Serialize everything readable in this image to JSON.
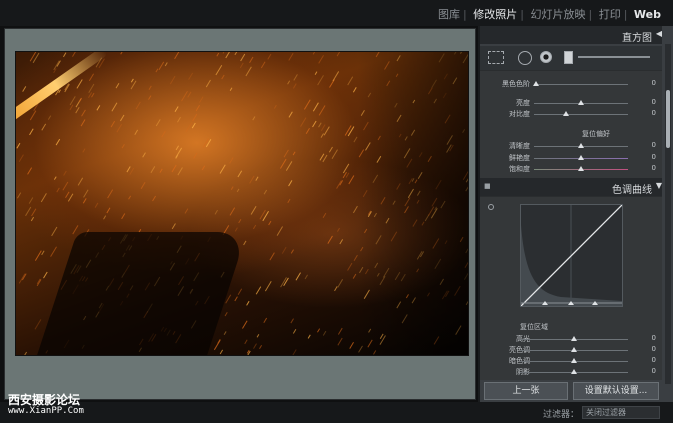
{
  "modules": [
    "图库",
    "修改照片",
    "幻灯片放映",
    "打印",
    "Web"
  ],
  "active_module": "修改照片",
  "panel": {
    "histogram_title": "直方图",
    "color_section": {
      "rows": [
        {
          "label": "黑色色阶",
          "value": "0",
          "pos": 0.05
        }
      ],
      "presence_rows": [
        {
          "label": "亮度",
          "value": "0",
          "pos": 0.5
        },
        {
          "label": "对比度",
          "value": "0",
          "pos": 0.5
        }
      ],
      "presence_title": "复位偏好",
      "clarity_rows": [
        {
          "label": "清晰度",
          "value": "0",
          "pos": 0.5
        },
        {
          "label": "鲜艳度",
          "value": "0",
          "pos": 0.5
        },
        {
          "label": "饱和度",
          "value": "0",
          "pos": 0.5
        }
      ]
    },
    "tone_curve_title": "色调曲线",
    "region_title": "复位区域",
    "region_rows": [
      {
        "label": "高光",
        "value": "0",
        "pos": 0.5
      },
      {
        "label": "亮色调",
        "value": "0",
        "pos": 0.5
      },
      {
        "label": "暗色调",
        "value": "0",
        "pos": 0.5
      },
      {
        "label": "阴影",
        "value": "0",
        "pos": 0.5
      }
    ],
    "prev_button": "上一张",
    "reset_button": "设置默认设置..."
  },
  "bottom": {
    "filter_label": "过滤器：",
    "filter_value": "关闭过滤器"
  },
  "watermark": {
    "line1": "西安摄影论坛",
    "line2": "www.XianPP.Com"
  }
}
